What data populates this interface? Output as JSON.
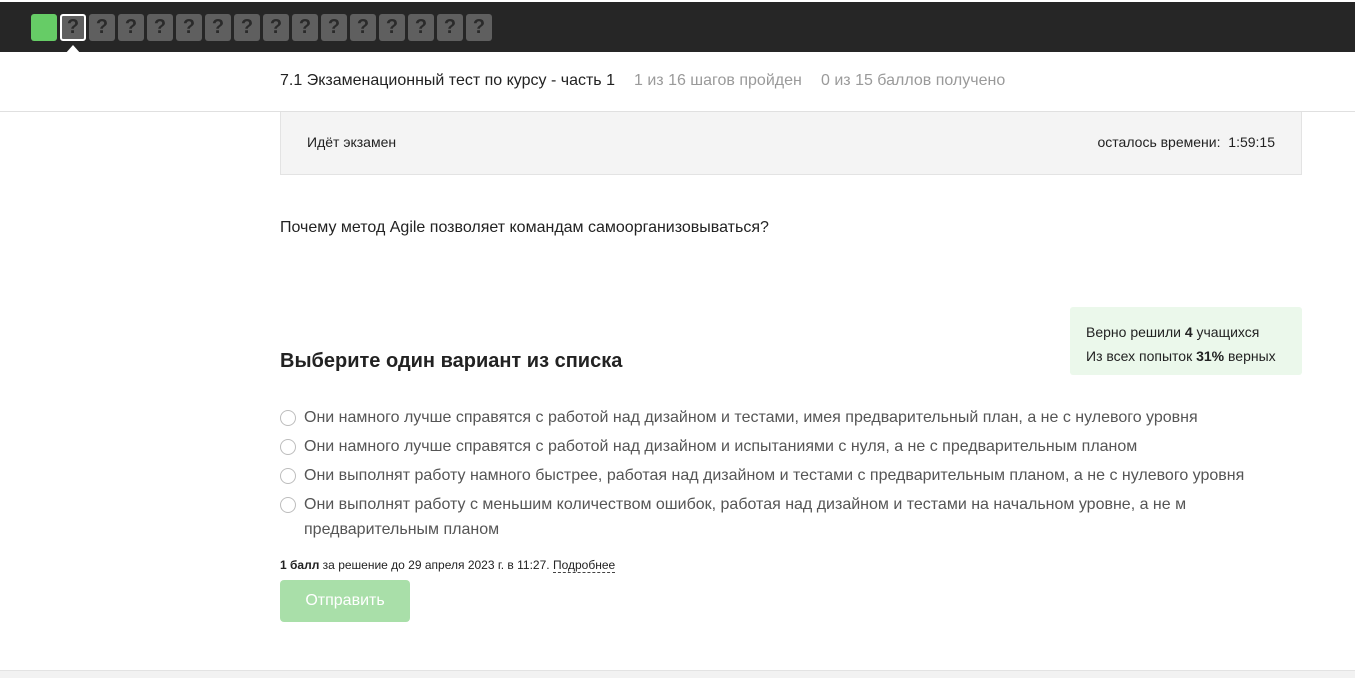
{
  "nav": {
    "steps": [
      {
        "label": "",
        "state": "done"
      },
      {
        "label": "?",
        "state": "current"
      },
      {
        "label": "?",
        "state": "todo"
      },
      {
        "label": "?",
        "state": "todo"
      },
      {
        "label": "?",
        "state": "todo"
      },
      {
        "label": "?",
        "state": "todo"
      },
      {
        "label": "?",
        "state": "todo"
      },
      {
        "label": "?",
        "state": "todo"
      },
      {
        "label": "?",
        "state": "todo"
      },
      {
        "label": "?",
        "state": "todo"
      },
      {
        "label": "?",
        "state": "todo"
      },
      {
        "label": "?",
        "state": "todo"
      },
      {
        "label": "?",
        "state": "todo"
      },
      {
        "label": "?",
        "state": "todo"
      },
      {
        "label": "?",
        "state": "todo"
      },
      {
        "label": "?",
        "state": "todo"
      }
    ],
    "colors": {
      "done": "#66cc66",
      "todo": "#5f5f5f",
      "bar": "#262626"
    }
  },
  "header": {
    "title": "7.1 Экзаменационный тест по курсу - часть 1",
    "progress": "1 из 16 шагов пройден",
    "score": "0 из 15 баллов  получено"
  },
  "exam": {
    "status": "Идёт экзамен",
    "timer_label": "осталось времени:",
    "timer_value": "1:59:15"
  },
  "question": {
    "text": "Почему метод Agile позволяет командам самоорганизовываться?"
  },
  "stats": {
    "solved_prefix": "Верно решили",
    "solved_count": "4",
    "solved_suffix": "учащихся",
    "attempts_prefix": "Из всех попыток",
    "attempts_percent": "31%",
    "attempts_suffix": "верных"
  },
  "choice": {
    "title": "Выберите один вариант из списка",
    "options": [
      "Они намного лучше справятся с работой над дизайном и тестами, имея предварительный план, а не с нулевого уровня",
      "Они намного лучше справятся с работой над дизайном и испытаниями с нуля, а не с предварительным планом",
      "Они выполнят работу намного быстрее, работая над дизайном и тестами с предварительным планом, а не с нулевого уровня",
      "Они выполнят работу с меньшим количеством ошибок, работая над дизайном и тестами на начальном уровне, а не м предварительным планом"
    ]
  },
  "points": {
    "amount": "1 балл",
    "deadline": " за решение до 29 апреля 2023 г. в 11:27. ",
    "more_link": "Подробнее"
  },
  "submit": {
    "label": "Отправить",
    "color": "#a9dfa9"
  }
}
